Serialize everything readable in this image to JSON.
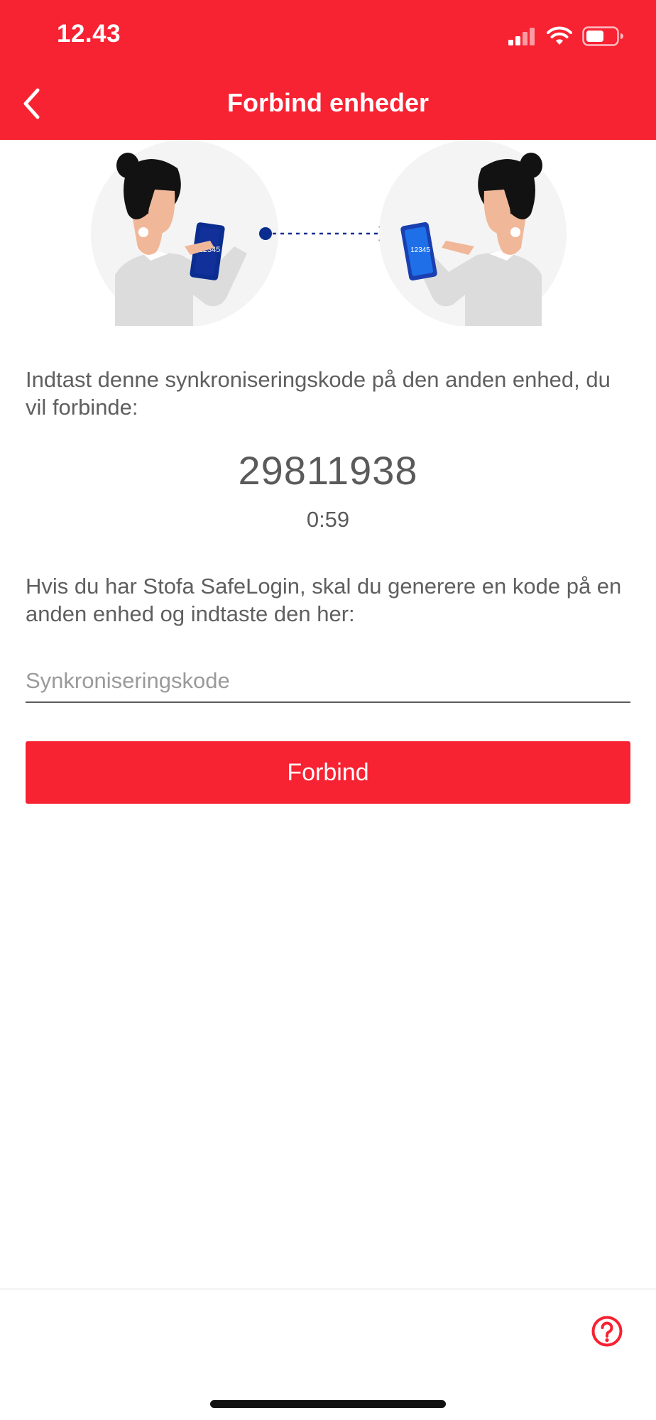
{
  "status_bar": {
    "time": "12.43",
    "signal_icon": "cellular-signal-icon",
    "wifi_icon": "wifi-icon",
    "battery_icon": "battery-icon"
  },
  "nav": {
    "title": "Forbind enheder",
    "back_icon": "chevron-left-icon"
  },
  "illustration": {
    "left_phone_text": "12345",
    "right_phone_text": "12345",
    "arrow_icon": "dotted-arrow-icon"
  },
  "main": {
    "instruction_1": "Indtast denne synkroniseringskode på den anden enhed, du vil forbinde:",
    "sync_code": "29811938",
    "countdown": "0:59",
    "instruction_2": "Hvis du har Stofa SafeLogin, skal du generere en kode på en anden enhed og indtaste den her:",
    "input_placeholder": "Synkroniseringskode",
    "input_value": "",
    "connect_label": "Forbind"
  },
  "footer": {
    "help_icon": "question-circle-icon"
  },
  "colors": {
    "brand_red": "#f72232",
    "text_gray": "#5f5f5f",
    "phone_dark": "#0a2d8f",
    "phone_light": "#1e6fe8"
  }
}
